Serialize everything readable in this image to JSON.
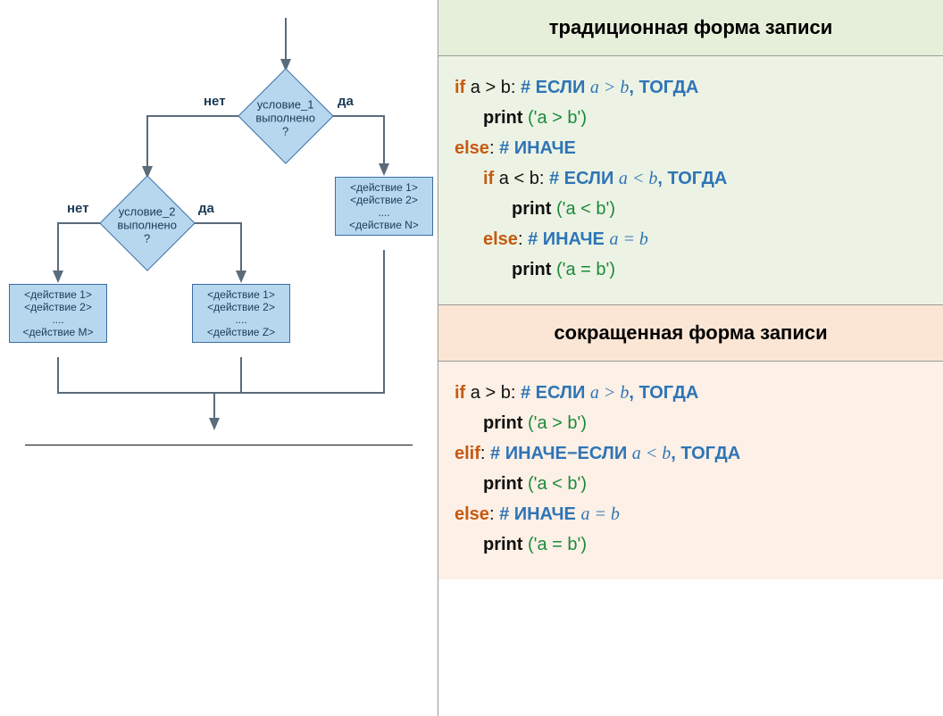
{
  "flowchart": {
    "labels": {
      "yes": "да",
      "no": "нет"
    },
    "cond1": {
      "line1": "условие_1",
      "line2": "выполнено",
      "line3": "?"
    },
    "cond2": {
      "line1": "условие_2",
      "line2": "выполнено",
      "line3": "?"
    },
    "boxN": {
      "l1": "<действие 1>",
      "l2": "<действие 2>",
      "l3": "....",
      "l4": "<действие N>"
    },
    "boxZ": {
      "l1": "<действие 1>",
      "l2": "<действие 2>",
      "l3": "....",
      "l4": "<действие Z>"
    },
    "boxM": {
      "l1": "<действие 1>",
      "l2": "<действие 2>",
      "l3": "....",
      "l4": "<действие M>"
    }
  },
  "right": {
    "header1": "традиционная форма записи",
    "header2": "сокращенная форма записи",
    "code1": {
      "l1_kw": "if",
      "l1_cond": " a > b",
      "l1_colon": ":   ",
      "l1_c_pre": "# ЕСЛИ ",
      "l1_c_math": "a  >  b",
      "l1_c_post": ", ТОГДА",
      "l2_pr": "print",
      "l2_arg": " ('a > b')",
      "l3_kw": "else",
      "l3_colon": ":      ",
      "l3_c": "# ИНАЧЕ",
      "l4_kw": "if",
      "l4_cond": " a < b",
      "l4_colon": ":    ",
      "l4_c_pre": "# ЕСЛИ ",
      "l4_c_math": "a <  b",
      "l4_c_post": ", ТОГДА",
      "l5_pr": "print",
      "l5_arg": " ('a < b')",
      "l6_kw": "else",
      "l6_colon": ":      ",
      "l6_c_pre": "# ИНАЧЕ ",
      "l6_c_math": "a =  b",
      "l7_pr": "print",
      "l7_arg": " ('a = b')"
    },
    "code2": {
      "l1_kw": "if",
      "l1_cond": " a > b",
      "l1_colon": ":    ",
      "l1_c_pre": "# ЕСЛИ ",
      "l1_c_math": "a  >  b",
      "l1_c_post": ", ТОГДА",
      "l2_pr": "print",
      "l2_arg": " ('a > b')",
      "l3_kw": "elif",
      "l3_colon": ":   ",
      "l3_c_pre": "# ИНАЧЕ−ЕСЛИ ",
      "l3_c_math": "a <  b",
      "l3_c_post": ", ТОГДА",
      "l4_pr": "print",
      "l4_arg": " ('a < b')",
      "l5_kw": "else",
      "l5_colon": ":     ",
      "l5_c_pre": "# ИНАЧЕ ",
      "l5_c_math": "a =  b",
      "l6_pr": "print",
      "l6_arg": " ('a = b')"
    }
  }
}
